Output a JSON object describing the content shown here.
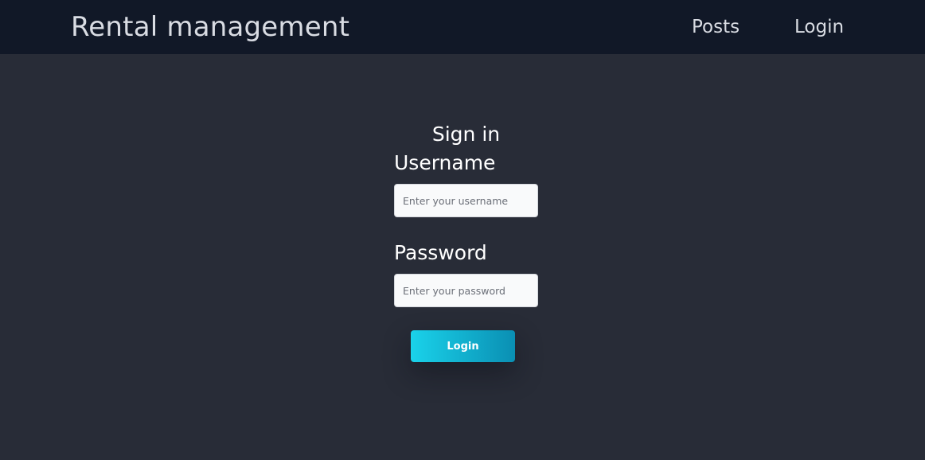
{
  "navbar": {
    "brand": "Rental management",
    "links": [
      {
        "label": "Posts"
      },
      {
        "label": "Login"
      }
    ]
  },
  "signin": {
    "title": "Sign in",
    "username": {
      "label": "Username",
      "placeholder": "Enter your username",
      "value": ""
    },
    "password": {
      "label": "Password",
      "placeholder": "Enter your password",
      "value": ""
    },
    "submit_label": "Login"
  },
  "colors": {
    "page_background": "#282c37",
    "navbar_background": "#111827",
    "button_gradient_start": "#1ad2ea",
    "button_gradient_end": "#0a8fb3"
  }
}
